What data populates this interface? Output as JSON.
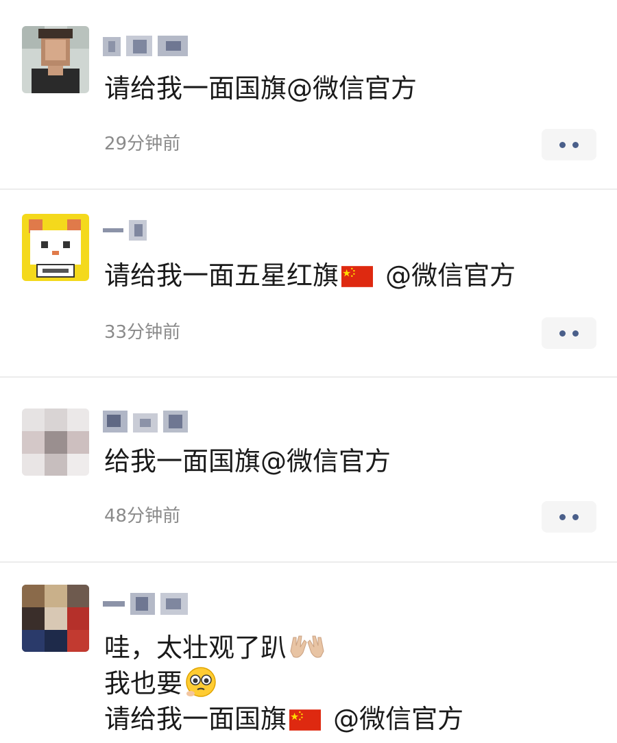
{
  "comments": [
    {
      "lines": [
        "请给我一面国旗@微信官方"
      ],
      "time": "29分钟前",
      "avatar_icon": "person-photo-avatar-icon",
      "more_icon": "more-options-icon"
    },
    {
      "lines_parts": [
        "请给我一面五星红旗",
        " @微信官方"
      ],
      "time": "33分钟前",
      "avatar_icon": "cartoon-cat-avatar-icon",
      "inline_icon": "china-flag-icon",
      "more_icon": "more-options-icon"
    },
    {
      "lines": [
        "给我一面国旗@微信官方"
      ],
      "time": "48分钟前",
      "avatar_icon": "blurred-photo-avatar-icon",
      "more_icon": "more-options-icon"
    },
    {
      "line1": "哇，太壮观了趴",
      "line2": "我也要",
      "line3_parts": [
        "请给我一面国旗",
        " @微信官方"
      ],
      "avatar_icon": "blurred-photo-avatar-icon",
      "inline_icons": [
        "clapping-hands-icon",
        "pleading-face-icon",
        "china-flag-icon"
      ]
    }
  ],
  "colors": {
    "text": "#1a1a1a",
    "time": "#8a8a8a",
    "divider": "#ececec",
    "more_dots": "#4a5f8a",
    "flag_red": "#de2910",
    "flag_yellow": "#ffde00"
  }
}
